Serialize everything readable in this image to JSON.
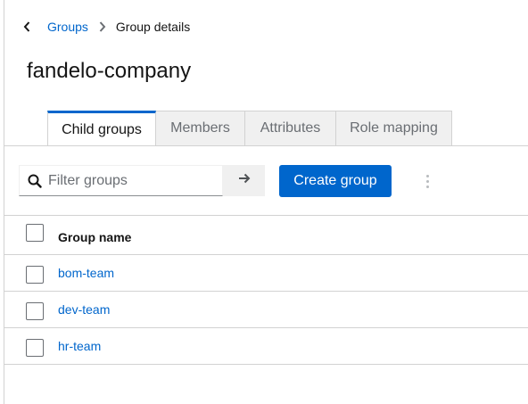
{
  "breadcrumb": {
    "back_icon": "chevron-left-icon",
    "items": [
      "Groups",
      "Group details"
    ],
    "separator_icon": "chevron-right-icon"
  },
  "page": {
    "title": "fandelo-company"
  },
  "tabs": [
    {
      "label": "Child groups",
      "active": true
    },
    {
      "label": "Members",
      "active": false
    },
    {
      "label": "Attributes",
      "active": false
    },
    {
      "label": "Role mapping",
      "active": false
    }
  ],
  "toolbar": {
    "search_placeholder": "Filter groups",
    "search_value": "",
    "search_icon": "search-icon",
    "go_icon": "arrow-right-icon",
    "create_label": "Create group",
    "kebab_icon": "kebab-menu-icon"
  },
  "table": {
    "columns": [
      "Group name"
    ],
    "rows": [
      {
        "name": "bom-team"
      },
      {
        "name": "dev-team"
      },
      {
        "name": "hr-team"
      }
    ]
  },
  "colors": {
    "accent": "#0066cc",
    "text": "#151515",
    "muted": "#6a6e73",
    "border": "#d2d2d2"
  }
}
